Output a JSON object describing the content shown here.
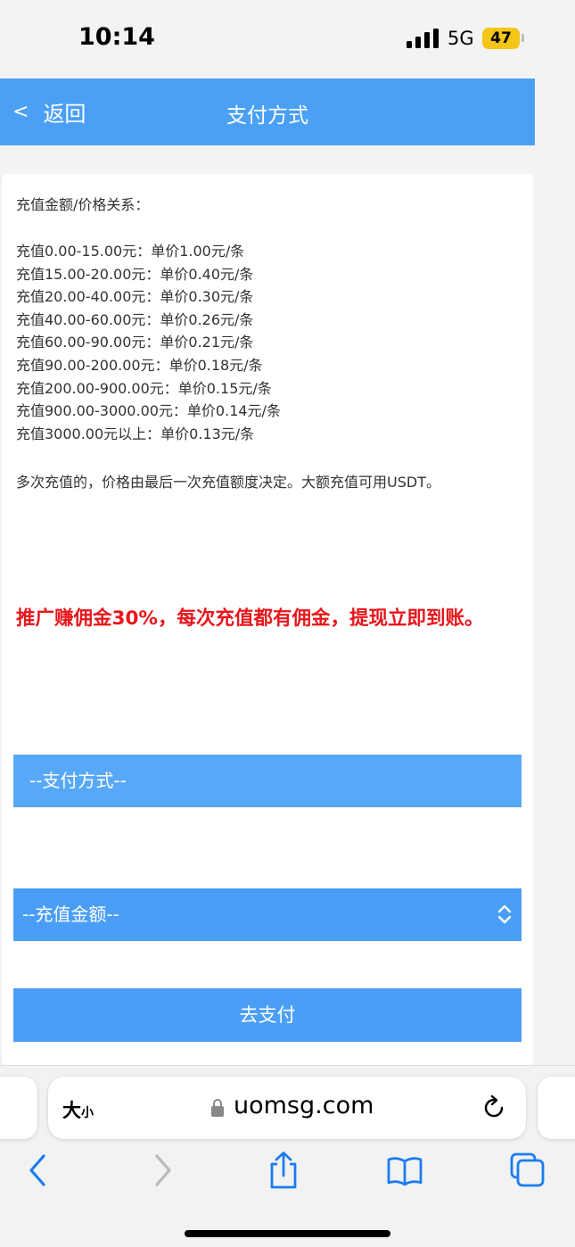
{
  "status": {
    "time": "10:14",
    "network": "5G",
    "battery": "47"
  },
  "header": {
    "back_label": "返回",
    "back_chevron": "<",
    "title": "支付方式"
  },
  "content": {
    "price_heading": "充值金额/价格关系：",
    "price_rows": [
      "充值0.00-15.00元：单价1.00元/条",
      "充值15.00-20.00元：单价0.40元/条",
      "充值20.00-40.00元：单价0.30元/条",
      "充值40.00-60.00元：单价0.26元/条",
      "充值60.00-90.00元：单价0.21元/条",
      "充值90.00-200.00元：单价0.18元/条",
      "充值200.00-900.00元：单价0.15元/条",
      "充值900.00-3000.00元：单价0.14元/条",
      "充值3000.00元以上：单价0.13元/条"
    ],
    "multi_note": "多次充值的，价格由最后一次充值额度决定。大额充值可用USDT。",
    "promo": "推广赚佣金30%，每次充值都有佣金，提现立即到账。"
  },
  "form": {
    "pay_method_placeholder": "--支付方式--",
    "amount_placeholder": "--充值金额--",
    "submit_label": "去支付"
  },
  "browser": {
    "text_size_big": "大",
    "text_size_small": "小",
    "url": "uomsg.com"
  },
  "colors": {
    "primary": "#4aa0f5",
    "promo": "#e8161b",
    "ios_blue": "#1a7cf0"
  },
  "icons": [
    "lock-icon",
    "reload-icon",
    "back-arrow-icon",
    "forward-arrow-icon",
    "share-icon",
    "bookmarks-icon",
    "tabs-icon"
  ]
}
